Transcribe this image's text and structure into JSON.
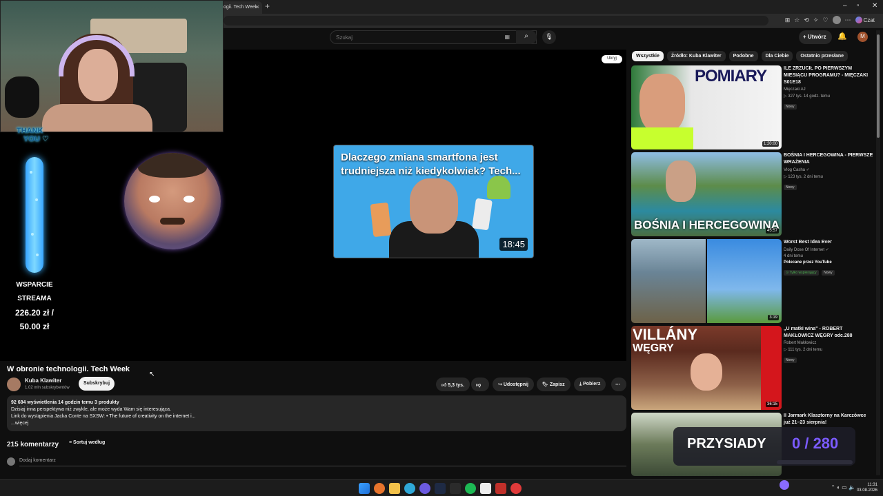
{
  "browser": {
    "tab_title": "ogii. Tech Week",
    "tab_close": "×",
    "new_tab": "+",
    "win_min": "–",
    "win_max": "▫",
    "win_close": "✕",
    "chat_label": "Czat"
  },
  "header": {
    "search_placeholder": "Szukaj",
    "create_label": "Utwórz",
    "avatar_letter": "M"
  },
  "overlay": {
    "thank_line1": "THANK",
    "thank_line2": "YOU",
    "support_line1": "WSPARCIE",
    "support_line2": "STREAMA",
    "amount_current": "226.20 zł /",
    "amount_goal": "50.00 zł",
    "squat_label": "PRZYSIADY",
    "squat_value": "0 / 280"
  },
  "player": {
    "hide_label": "Ukryj",
    "end_card_title": "Dlaczego zmiana smartfona jest trudniejsza niż kiedykolwiek? Tech...",
    "end_card_duration": "18:45"
  },
  "video": {
    "title": "W obronie technologii. Tech Week",
    "channel": "Kuba Klawiter",
    "subscribers": "1,02 mln subskrybentów",
    "subscribe_label": "Subskrybuj",
    "likes": "5,3 tys.",
    "share_label": "Udostępnij",
    "save_label": "Zapisz",
    "download_label": "Pobierz",
    "more_label": "⋯",
    "desc_meta": "92 684 wyświetlenia  14 godzin temu  3 produkty",
    "desc_line1": "Dzisiaj inna perspektywa niż zwykle, ale może wyda Wam się interesująca.",
    "desc_line2": "Link do wystąpienia Jacka Conte na SXSW:",
    "desc_link": "• The future of creativity on the internet i...",
    "desc_more": "...więcej"
  },
  "comments": {
    "count": "215 komentarzy",
    "sort_label": "Sortuj według",
    "add_placeholder": "Dodaj komentarz"
  },
  "chips": [
    "Wszystkie",
    "Źródło: Kuba Klawiter",
    "Podobne",
    "Dla Ciebie",
    "Ostatnio przesłane"
  ],
  "recommendations": [
    {
      "title": "ILE ZRZUCIŁ PO PIERWSZYM MIESIĄCU PROGRAMU? - MIĘCZAKI S01E18",
      "channel": "Mięczaki AJ",
      "meta": "▷ 327 tys.  14 godz. temu",
      "badge": "Nowy",
      "duration": "1:20:00",
      "thumb_text": "POMIARY"
    },
    {
      "title": "BOŚNIA I HERCEGOWINA - PIERWSZE WRAŻENIA",
      "channel": "Vlog Casha ✓",
      "meta": "▷ 123 tys.  2 dni temu",
      "badge": "Nowy",
      "duration": "45:57",
      "thumb_text": "BOŚNIA I HERCEGOWINA"
    },
    {
      "title": "Worst Best Idea Ever",
      "channel": "Daily Dose Of Internet ✓",
      "meta": "4 dni temu",
      "promo": "Polecane przez YouTube",
      "badge_green": "⊙ Tylko wspierający",
      "badge": "Nowy",
      "duration": "3:19"
    },
    {
      "title": "„U matki wina\" - ROBERT MAKŁOWICZ WĘGRY odc.288",
      "channel": "Robert Makłowicz",
      "meta": "▷ 111 tys.  2 dni temu",
      "badge": "Nowy",
      "duration": "36:15",
      "thumb_text": "VILLÁNY",
      "thumb_text2": "WĘGRY"
    },
    {
      "title": "II Jarmark Klasztorny na Karczówce już 21–23 sierpnia!",
      "channel": "",
      "meta": ""
    }
  ],
  "taskbar": {
    "clock_time": "11:31",
    "clock_date": "03.08.2026",
    "tray": "⌃  ◐  ▭  🔈"
  }
}
